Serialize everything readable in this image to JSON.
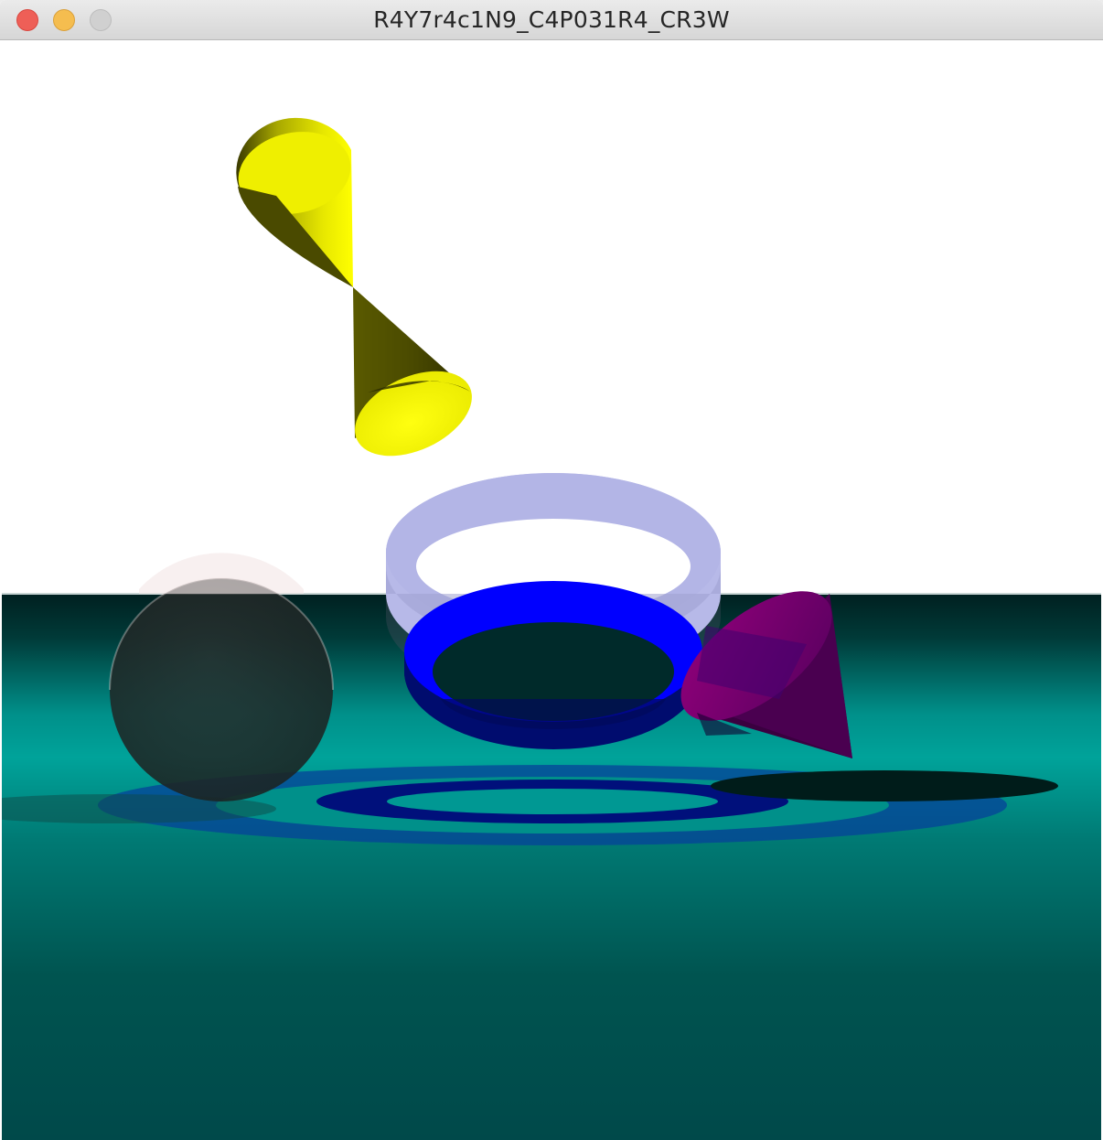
{
  "window": {
    "title": "R4Y7r4c1N9_C4P031R4_CR3W",
    "controls": {
      "close_icon": "close-dot-icon",
      "minimize_icon": "minimize-dot-icon",
      "zoom_icon": "zoom-dot-icon"
    }
  },
  "scene": {
    "sky_color": "#ffffff",
    "floor_color": "#00a39a",
    "objects": [
      {
        "kind": "double-cone",
        "color": "#ffff00"
      },
      {
        "kind": "hollow-cylinder",
        "color": "#b7b9e8"
      },
      {
        "kind": "hollow-cylinder",
        "color": "#0000ff"
      },
      {
        "kind": "cone",
        "color": "#8a007a"
      },
      {
        "kind": "sphere",
        "color": "#f3e6e6"
      }
    ]
  }
}
